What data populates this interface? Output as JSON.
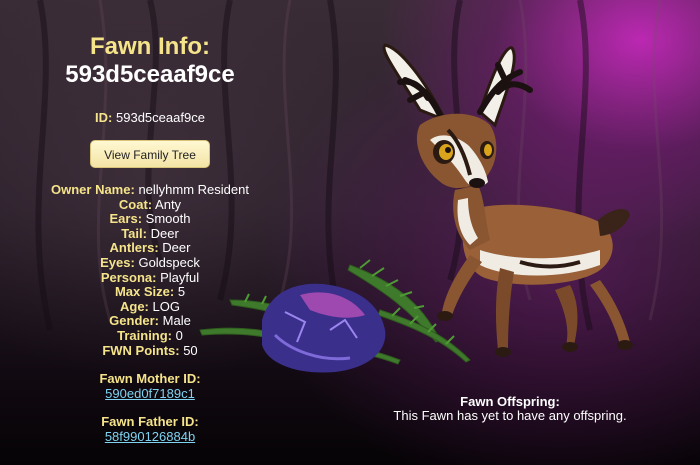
{
  "title": {
    "line1": "Fawn Info:",
    "line2": "593d5ceaaf9ce"
  },
  "id_line": {
    "label": "ID:",
    "value": "593d5ceaaf9ce"
  },
  "family_tree_button": "View Family Tree",
  "attributes": [
    {
      "label": "Owner Name:",
      "value": "nellyhmm Resident"
    },
    {
      "label": "Coat:",
      "value": "Anty"
    },
    {
      "label": "Ears:",
      "value": "Smooth"
    },
    {
      "label": "Tail:",
      "value": "Deer"
    },
    {
      "label": "Antlers:",
      "value": "Deer"
    },
    {
      "label": "Eyes:",
      "value": "Goldspeck"
    },
    {
      "label": "Persona:",
      "value": "Playful"
    },
    {
      "label": "Max Size:",
      "value": "5"
    },
    {
      "label": "Age:",
      "value": "LOG"
    },
    {
      "label": "Gender:",
      "value": "Male"
    },
    {
      "label": "Training:",
      "value": "0"
    },
    {
      "label": "FWN Points:",
      "value": "50"
    }
  ],
  "mother": {
    "label": "Fawn Mother ID:",
    "link": "590ed0f7189c1"
  },
  "father": {
    "label": "Fawn Father ID:",
    "link": "58f990126884b"
  },
  "offspring": {
    "heading": "Fawn Offspring:",
    "text": "This Fawn has yet to have any offspring."
  },
  "colors": {
    "accent": "#f5e48a",
    "link": "#7fd3f0",
    "glow": "#d228c8"
  },
  "icons": [
    "deer-illustration",
    "crystal-rock",
    "fern-plant"
  ]
}
